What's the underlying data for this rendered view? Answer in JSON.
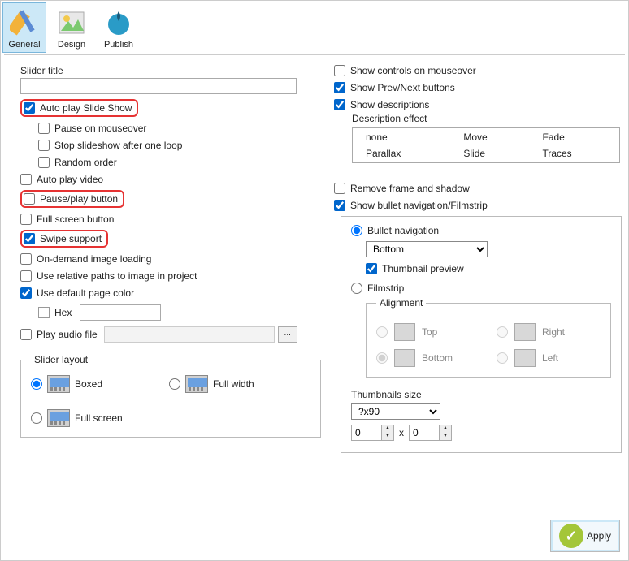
{
  "toolbar": {
    "items": [
      {
        "label": "General"
      },
      {
        "label": "Design"
      },
      {
        "label": "Publish"
      }
    ]
  },
  "left": {
    "slider_title_label": "Slider title",
    "slider_title_value": "",
    "autoplay": "Auto play Slide Show",
    "pause_mouseover": "Pause on mouseover",
    "stop_one_loop": "Stop slideshow after one loop",
    "random_order": "Random order",
    "autoplay_video": "Auto play video",
    "pause_play_button": "Pause/play button",
    "fullscreen_button": "Full screen button",
    "swipe_support": "Swipe support",
    "ondemand_loading": "On-demand image loading",
    "relative_paths": "Use relative paths to image in project",
    "use_default_color": "Use default page color",
    "hex_label": "Hex",
    "hex_value": "",
    "play_audio": "Play audio file",
    "browse": "...",
    "layout": {
      "legend": "Slider layout",
      "boxed": "Boxed",
      "fullwidth": "Full width",
      "fullscreen": "Full screen"
    }
  },
  "right": {
    "show_controls": "Show controls on mouseover",
    "show_prevnext": "Show Prev/Next buttons",
    "show_descriptions": "Show descriptions",
    "desc_effect_label": "Description effect",
    "desc_effects": [
      [
        "none",
        "Move",
        "Fade"
      ],
      [
        "Parallax",
        "Slide",
        "Traces"
      ]
    ],
    "remove_frame": "Remove frame and shadow",
    "show_bullet_nav": "Show bullet navigation/Filmstrip",
    "bullet_nav": "Bullet navigation",
    "bullet_position": "Bottom",
    "thumb_preview": "Thumbnail preview",
    "filmstrip": "Filmstrip",
    "alignment": {
      "legend": "Alignment",
      "top": "Top",
      "right": "Right",
      "bottom": "Bottom",
      "left": "Left"
    },
    "thumb_size_label": "Thumbnails size",
    "thumb_size_preset": "?x90",
    "thumb_w": "0",
    "thumb_h": "0",
    "x": "x"
  },
  "apply": "Apply"
}
